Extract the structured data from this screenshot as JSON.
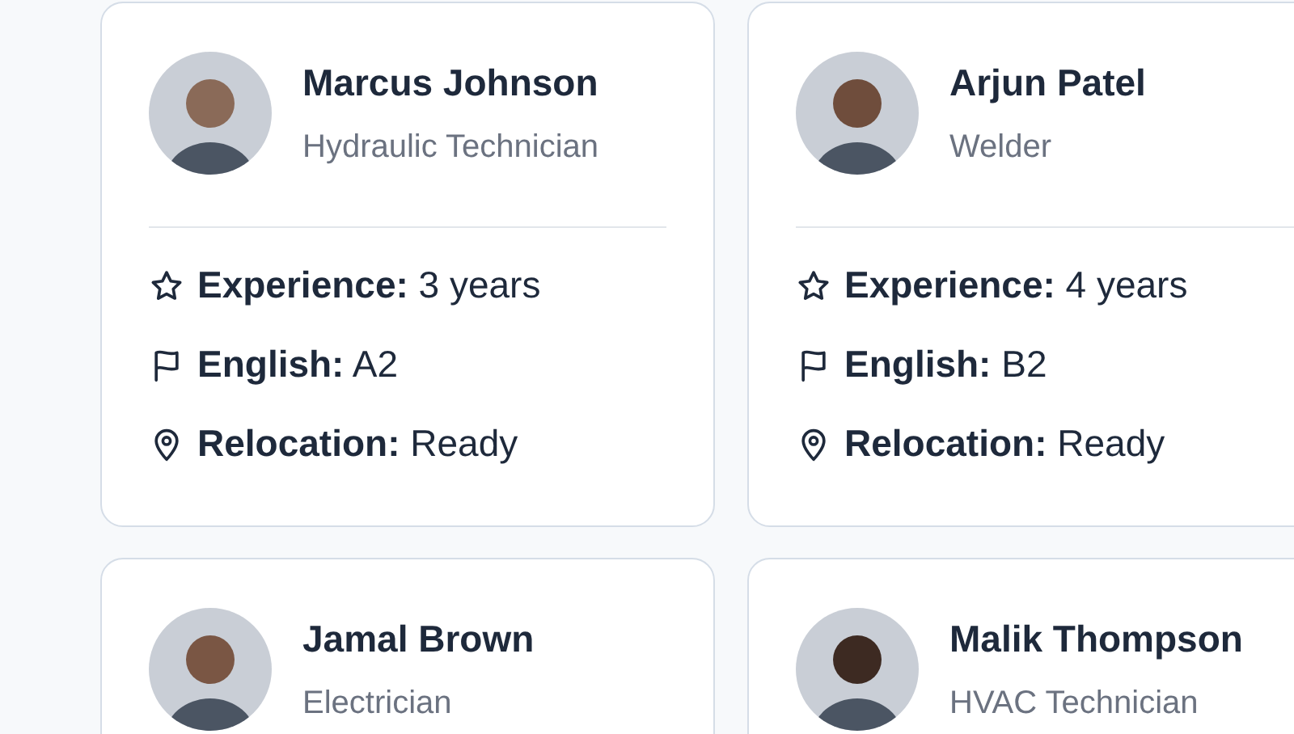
{
  "candidates": [
    {
      "name": "Marcus Johnson",
      "role": "Hydraulic Technician",
      "details": [
        {
          "kind": "experience",
          "label": "Experience:",
          "value": "3 years"
        },
        {
          "kind": "language",
          "label": "English:",
          "value": "A2"
        },
        {
          "kind": "relocation",
          "label": "Relocation:",
          "value": "Ready"
        }
      ]
    },
    {
      "name": "Arjun Patel",
      "role": "Welder",
      "details": [
        {
          "kind": "experience",
          "label": "Experience:",
          "value": "4 years"
        },
        {
          "kind": "language",
          "label": "English:",
          "value": "B2"
        },
        {
          "kind": "relocation",
          "label": "Relocation:",
          "value": "Ready"
        }
      ]
    },
    {
      "name": "Jamal Brown",
      "role": "Electrician"
    },
    {
      "name": "Malik Thompson",
      "role": "HVAC Technician"
    }
  ]
}
